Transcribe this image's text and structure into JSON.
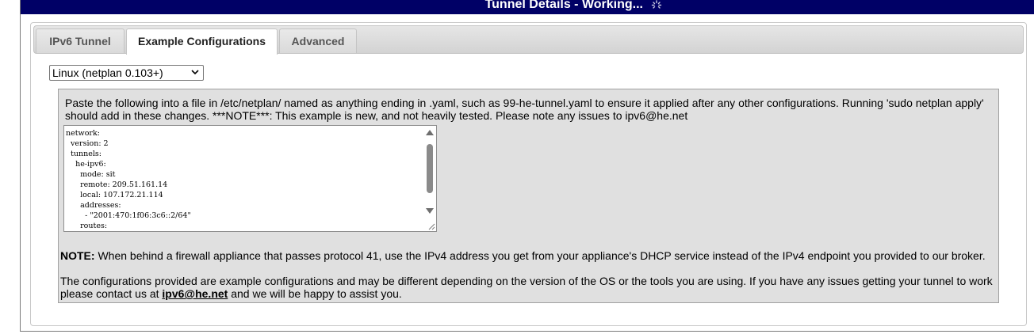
{
  "window": {
    "title": "Tunnel Details - Working..."
  },
  "tabs": [
    {
      "label": "IPv6 Tunnel",
      "active": false
    },
    {
      "label": "Example Configurations",
      "active": true
    },
    {
      "label": "Advanced",
      "active": false
    }
  ],
  "os_select": {
    "selected": "Linux (netplan 0.103+)"
  },
  "config": {
    "instructions": "Paste the following into a file in /etc/netplan/ named as anything ending in .yaml, such as 99-he-tunnel.yaml to ensure it applied after any other configurations. Running 'sudo netplan apply' should add in these changes. ***NOTE***: This example is new, and not heavily tested. Please note any issues to ipv6@he.net",
    "code": "network:\n  version: 2\n  tunnels:\n    he-ipv6:\n      mode: sit\n      remote: 209.51.161.14\n      local: 107.172.21.114\n      addresses:\n        - \"2001:470:1f06:3c6::2/64\"\n      routes:"
  },
  "note": {
    "label": "NOTE:",
    "text": " When behind a firewall appliance that passes protocol 41, use the IPv4 address you get from your appliance's DHCP service instead of the IPv4 endpoint you provided to our broker."
  },
  "disclaimer": {
    "text_before": "The configurations provided are example configurations and may be different depending on the version of the OS or the tools you are using. If you have any issues getting your tunnel to work please contact us at ",
    "email": "ipv6@he.net",
    "text_after": " and we will be happy to assist you."
  },
  "colors": {
    "titlebar_bg": "#000066",
    "config_box_bg": "#e0e0e0"
  },
  "icons": [
    "loading-spinner-icon",
    "dropdown-arrow-icon",
    "scroll-up-icon",
    "scroll-down-icon",
    "resize-grip-icon"
  ]
}
